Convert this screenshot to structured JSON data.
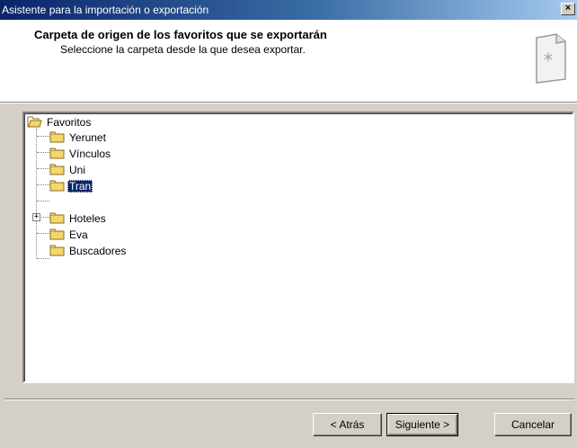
{
  "window": {
    "title": "Asistente para la importación o exportación",
    "close_label": "×"
  },
  "header": {
    "title": "Carpeta de origen de los favoritos que se exportarán",
    "subtitle": "Seleccione la carpeta desde la que desea exportar."
  },
  "tree": {
    "root": "Favoritos",
    "children": [
      {
        "label": "Yerunet"
      },
      {
        "label": "Vínculos"
      },
      {
        "label": "Uni"
      },
      {
        "label": "Tran",
        "selected": true
      },
      {
        "label": "Hoteles",
        "expandable": true,
        "expander": "+"
      },
      {
        "label": "Eva"
      },
      {
        "label": "Buscadores"
      }
    ]
  },
  "buttons": {
    "back_label": "< Atrás",
    "next_label": "Siguiente >",
    "cancel_label": "Cancelar"
  },
  "colors": {
    "title_bar_start": "#0a246a",
    "title_bar_end": "#a6caf0",
    "selection": "#0a246a",
    "folder_fill": "#f5d66c",
    "dialog_bg": "#d4d0c8"
  }
}
